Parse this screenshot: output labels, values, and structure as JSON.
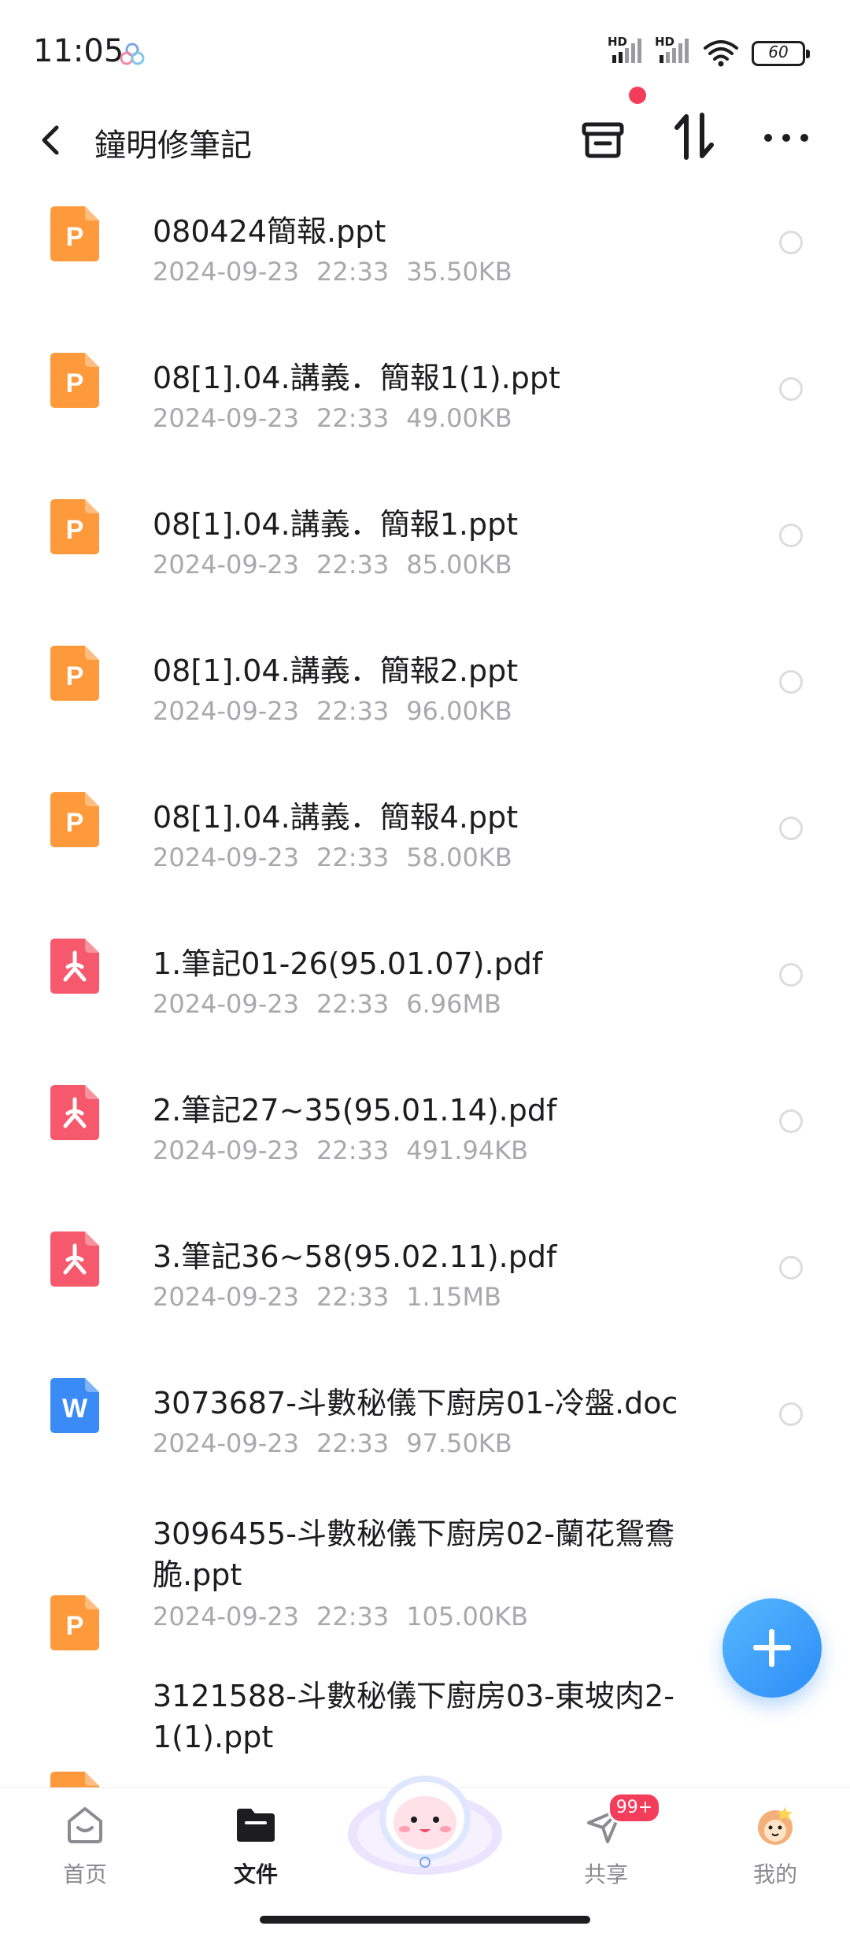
{
  "status_bar": {
    "time": "11:05",
    "signal_label": "HD",
    "battery": "60"
  },
  "header": {
    "title": "鐘明修筆記"
  },
  "files": [
    {
      "name": "080424簡報.ppt",
      "date": "2024-09-23",
      "time": "22:33",
      "size": "35.50KB",
      "type": "ppt"
    },
    {
      "name": "08[1].04.講義．簡報1(1).ppt",
      "date": "2024-09-23",
      "time": "22:33",
      "size": "49.00KB",
      "type": "ppt"
    },
    {
      "name": "08[1].04.講義．簡報1.ppt",
      "date": "2024-09-23",
      "time": "22:33",
      "size": "85.00KB",
      "type": "ppt"
    },
    {
      "name": "08[1].04.講義．簡報2.ppt",
      "date": "2024-09-23",
      "time": "22:33",
      "size": "96.00KB",
      "type": "ppt"
    },
    {
      "name": "08[1].04.講義．簡報4.ppt",
      "date": "2024-09-23",
      "time": "22:33",
      "size": "58.00KB",
      "type": "ppt"
    },
    {
      "name": "1.筆記01-26(95.01.07).pdf",
      "date": "2024-09-23",
      "time": "22:33",
      "size": "6.96MB",
      "type": "pdf"
    },
    {
      "name": "2.筆記27~35(95.01.14).pdf",
      "date": "2024-09-23",
      "time": "22:33",
      "size": "491.94KB",
      "type": "pdf"
    },
    {
      "name": "3.筆記36~58(95.02.11).pdf",
      "date": "2024-09-23",
      "time": "22:33",
      "size": "1.15MB",
      "type": "pdf"
    },
    {
      "name": "3073687-斗數秘儀下廚房01-冷盤.doc",
      "date": "2024-09-23",
      "time": "22:33",
      "size": "97.50KB",
      "type": "doc"
    },
    {
      "name": "3096455-斗數秘儀下廚房02-蘭花鴛鴦脆.ppt",
      "date": "2024-09-23",
      "time": "22:33",
      "size": "105.00KB",
      "type": "ppt"
    },
    {
      "name": "3121588-斗數秘儀下廚房03-東坡肉2-1(1).ppt",
      "date": "",
      "time": "",
      "size": "",
      "type": "ppt"
    }
  ],
  "icon_letters": {
    "ppt": "P",
    "doc": "W"
  },
  "colors": {
    "ppt": "#ff9a3c",
    "pdf": "#f5596b",
    "doc": "#3a8bf5",
    "fab": "#2a8cf6",
    "badge": "#f43d5a"
  },
  "bottom_nav": {
    "home": "首页",
    "files": "文件",
    "share": "共享",
    "mine": "我的",
    "share_badge": "99+"
  },
  "icons": {
    "back": "chevron-left-icon",
    "archive": "archive-box-icon",
    "sort": "sort-arrows-icon",
    "more": "more-dots-icon",
    "add": "plus-icon"
  }
}
